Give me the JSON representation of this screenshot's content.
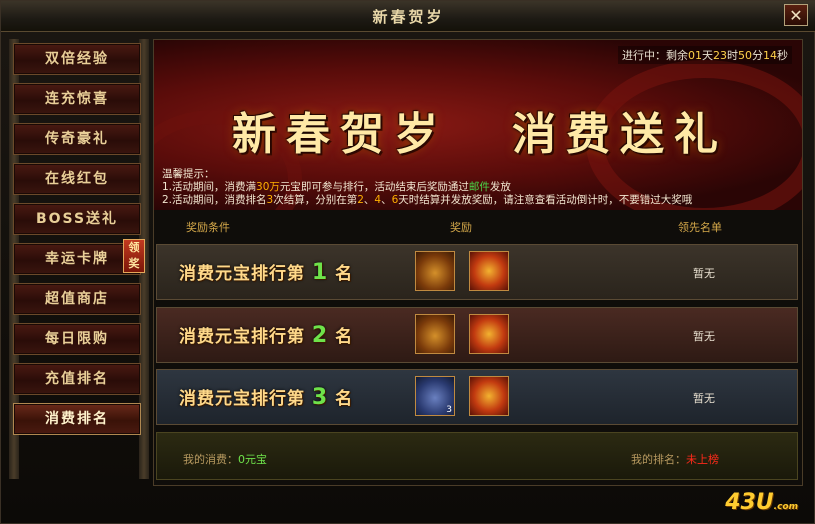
{
  "window": {
    "title": "新春贺岁",
    "close_icon": "close-icon"
  },
  "sidebar": {
    "items": [
      {
        "label": "双倍经验"
      },
      {
        "label": "连充惊喜"
      },
      {
        "label": "传奇豪礼"
      },
      {
        "label": "在线红包"
      },
      {
        "label": "BOSS送礼"
      },
      {
        "label": "幸运卡牌"
      },
      {
        "label": "超值商店"
      },
      {
        "label": "每日限购"
      },
      {
        "label": "充值排名"
      },
      {
        "label": "消费排名"
      }
    ],
    "badge": "领奖"
  },
  "banner": {
    "timer_prefix": "进行中：剩余",
    "timer_days": "01",
    "timer_day_unit": "天",
    "timer_hours": "23",
    "timer_hour_unit": "时",
    "timer_minutes": "50",
    "timer_min_unit": "分",
    "timer_seconds": "14",
    "timer_sec_unit": "秒",
    "slogan_left": "新春贺岁",
    "slogan_right": "消费送礼",
    "tips_title": "温馨提示：",
    "tip1_a": "1.活动期间，消费满",
    "tip1_b": "30万",
    "tip1_c": "元宝即可参与排行，活动结束后奖励通过",
    "tip1_d": "邮件",
    "tip1_e": "发放",
    "tip2_a": "2.活动期间，消费排名",
    "tip2_b": "3",
    "tip2_c": "次结算，分别在第",
    "tip2_d": "2",
    "tip2_e": "、",
    "tip2_f": "4",
    "tip2_g": "、",
    "tip2_h": "6",
    "tip2_i": "天时结算并发放奖励，请注意查看活动倒计时，不要错过大奖哦"
  },
  "table": {
    "headers": {
      "condition": "奖励条件",
      "reward": "奖励",
      "leader": "领先名单"
    },
    "rows": [
      {
        "prefix": "消费元宝排行第",
        "rank": "1",
        "unit": "名",
        "leader": "暂无",
        "chest_icon": "gold-chest-icon",
        "gift_icon": "gift-box-icon"
      },
      {
        "prefix": "消费元宝排行第",
        "rank": "2",
        "unit": "名",
        "leader": "暂无",
        "chest_icon": "silver-chest-icon",
        "gift_icon": "gift-box-icon"
      },
      {
        "prefix": "消费元宝排行第",
        "rank": "3",
        "unit": "名",
        "leader": "暂无",
        "chest_icon": "blue-chest-icon",
        "chest_qty": "3",
        "gift_icon": "gift-box-icon"
      }
    ]
  },
  "footer": {
    "my_spend_label": "我的消费：",
    "my_spend_value": "0元宝",
    "my_rank_label": "我的排名：",
    "my_rank_value": "未上榜"
  },
  "brand": {
    "logo_main": "43U",
    "logo_suffix": ".com"
  }
}
